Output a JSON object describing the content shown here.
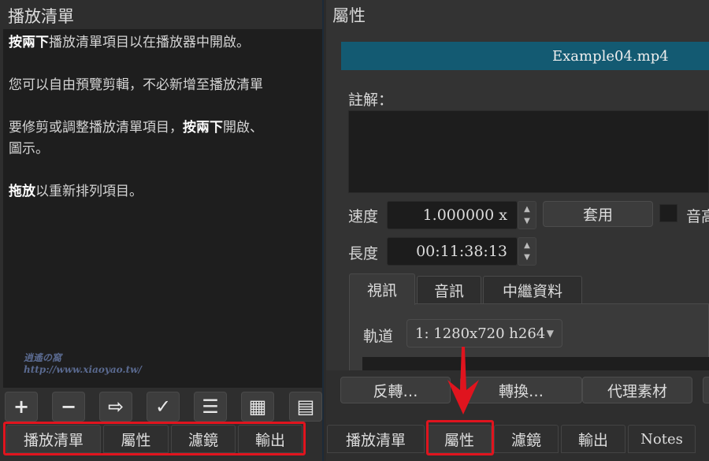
{
  "playlist": {
    "title": "播放清單",
    "help": {
      "line1_bold": "按兩下",
      "line1_rest": "播放清單項目以在播放器中開啟。",
      "line2": "您可以自由預覽剪輯，不必新增至播放清單",
      "line3_a": "要修剪或調整播放清單項目，",
      "line3_bold": "按兩下",
      "line3_b": "開啟、",
      "line3_c": "圖示。",
      "line4_bold": "拖放",
      "line4_rest": "以重新排列項目。"
    },
    "watermark": "http://www.xiaoyao.tw/",
    "toolbar": [
      {
        "icon": "plus-icon",
        "glyph": "+"
      },
      {
        "icon": "minus-icon",
        "glyph": "−"
      },
      {
        "icon": "insert-icon",
        "glyph": "⇨"
      },
      {
        "icon": "check-icon",
        "glyph": "✓"
      },
      {
        "icon": "list-view-icon",
        "glyph": "☰"
      },
      {
        "icon": "grid-view-icon",
        "glyph": "▦"
      },
      {
        "icon": "table-view-icon",
        "glyph": "▤"
      }
    ],
    "tabs": [
      "播放清單",
      "屬性",
      "濾鏡",
      "輸出"
    ]
  },
  "properties": {
    "title": "屬性",
    "filename": "Example04.mp4",
    "comments_label": "註解：",
    "speed_label": "速度",
    "speed_value": "1.000000 x",
    "apply_label": "套用",
    "pitch_label": "音高",
    "duration_label": "長度",
    "duration_value": "00:11:38:13",
    "tabs": [
      "視訊",
      "音訊",
      "中繼資料"
    ],
    "track_label": "軌道",
    "track_value": "1: 1280x720 h264",
    "buttons": [
      "反轉…",
      "轉換…",
      "代理素材"
    ]
  },
  "bottom_tabs": [
    "播放清單",
    "屬性",
    "濾鏡",
    "輸出",
    "Notes"
  ],
  "colors": {
    "accent": "#135a72",
    "highlight": "#e0141e"
  }
}
